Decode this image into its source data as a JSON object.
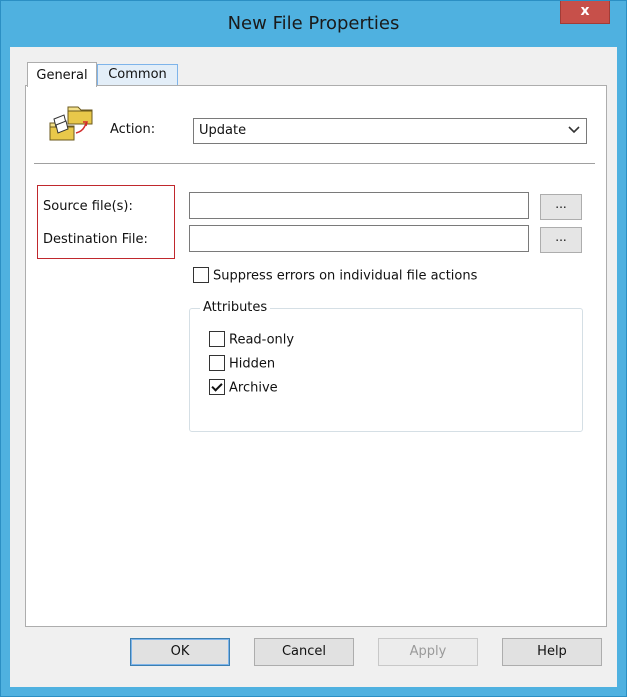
{
  "window": {
    "title": "New File Properties",
    "close_label": "x"
  },
  "tabs": [
    {
      "label": "General",
      "active": true
    },
    {
      "label": "Common",
      "active": false
    }
  ],
  "action": {
    "label": "Action:",
    "value": "Update"
  },
  "fields": {
    "source": {
      "label": "Source file(s):",
      "value": "",
      "browse_label": "..."
    },
    "destination": {
      "label": "Destination File:",
      "value": "",
      "browse_label": "..."
    }
  },
  "suppress": {
    "label": "Suppress errors on individual file actions",
    "checked": false
  },
  "attributes": {
    "title": "Attributes",
    "items": [
      {
        "label": "Read-only",
        "checked": false
      },
      {
        "label": "Hidden",
        "checked": false
      },
      {
        "label": "Archive",
        "checked": true
      }
    ]
  },
  "buttons": {
    "ok": "OK",
    "cancel": "Cancel",
    "apply": "Apply",
    "help": "Help"
  },
  "colors": {
    "title_bar": "#4fb1e0",
    "close_button": "#c7504a",
    "highlight_box": "#c0282d"
  },
  "icons": {
    "action": "file-copy-icon",
    "dropdown": "chevron-down-icon"
  }
}
